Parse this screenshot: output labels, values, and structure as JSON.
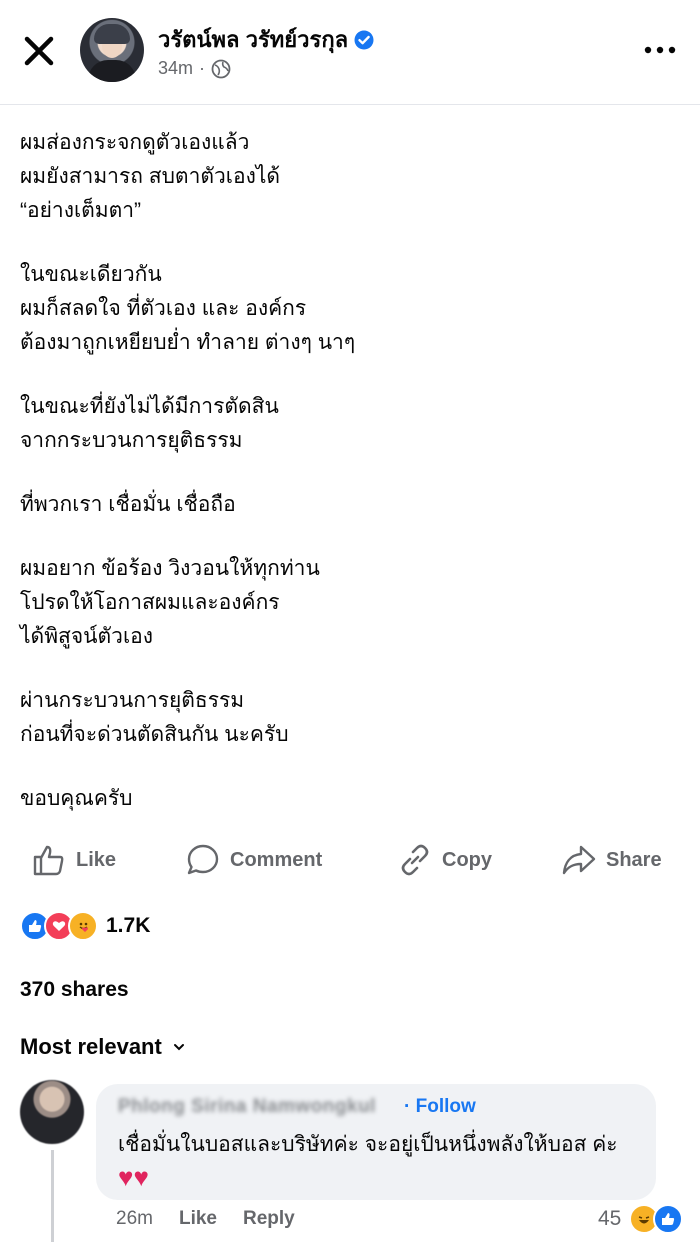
{
  "header": {
    "author_name": "วรัตน์พล วรัทย์วรกุล",
    "time": "34m",
    "separator": "·"
  },
  "post": {
    "paragraphs": [
      [
        "ผมส่องกระจกดูตัวเองแล้ว",
        "ผมยังสามารถ สบตาตัวเองได้",
        "“อย่างเต็มตา”"
      ],
      [
        "ในขณะเดียวกัน",
        "ผมก็สลดใจ ที่ตัวเอง และ องค์กร",
        "ต้องมาถูกเหยียบย่ำ ทำลาย ต่างๆ นาๆ"
      ],
      [
        "ในขณะที่ยังไม่ได้มีการตัดสิน",
        "จากกระบวนการยุติธรรม"
      ],
      [
        "ที่พวกเรา เชื่อมั่น เชื่อถือ"
      ],
      [
        "ผมอยาก ข้อร้อง วิงวอนให้ทุกท่าน",
        "โปรดให้โอกาสผมและองค์กร",
        "ได้พิสูจน์ตัวเอง"
      ],
      [
        "ผ่านกระบวนการยุติธรรม",
        "ก่อนที่จะด่วนตัดสินกัน นะครับ"
      ],
      [
        "ขอบคุณครับ"
      ]
    ]
  },
  "actions": {
    "like": "Like",
    "comment": "Comment",
    "copy": "Copy",
    "share": "Share"
  },
  "reactions": {
    "count": "1.7K",
    "types": [
      "like",
      "love",
      "care"
    ],
    "colors": {
      "like": "#1877f2",
      "love": "#f33e58",
      "care": "#f7b125"
    }
  },
  "shares_text": "370 shares",
  "sort_label": "Most relevant",
  "comment": {
    "author_name": "Phlong Sirina Namwongkul",
    "follow": "· Follow",
    "text": "เชื่อมั่นในบอสและบริษัทค่ะ จะอยู่เป็นหนึ่งพลังให้บอส ค่ะ",
    "hearts": "♥♥",
    "time": "26m",
    "like": "Like",
    "reply": "Reply",
    "reaction_count": "45",
    "reaction_types": [
      "haha",
      "like"
    ]
  },
  "colors": {
    "accent": "#1877f2",
    "muted": "#65676b",
    "bubble": "#f0f2f5"
  }
}
